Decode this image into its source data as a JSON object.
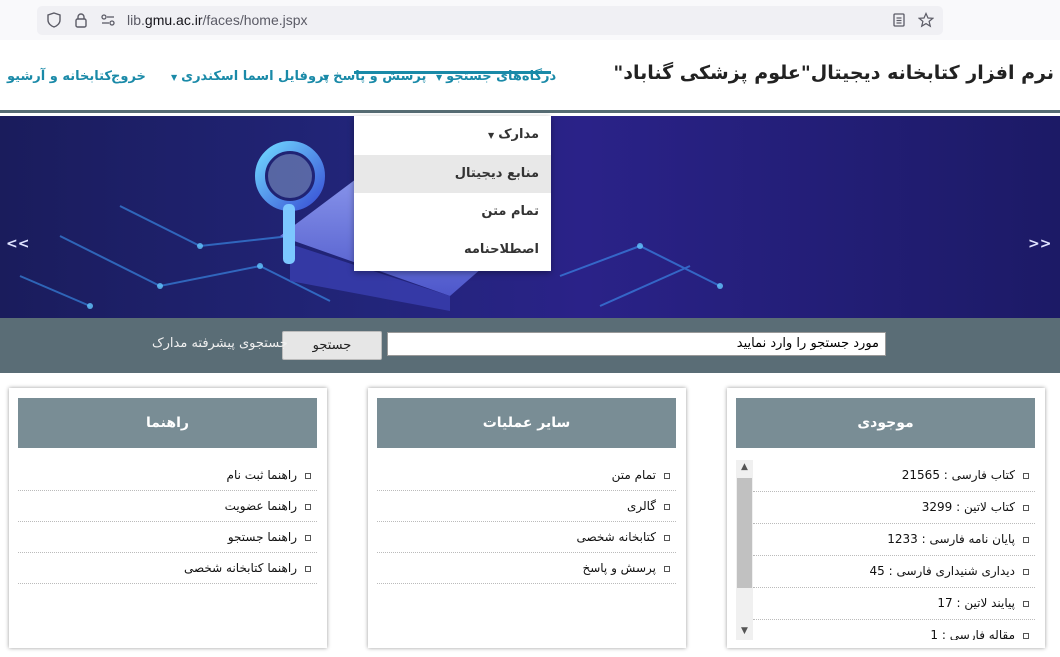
{
  "browser": {
    "url_prefix": "lib.",
    "url_domain": "gmu.ac.ir",
    "url_path": "/faces/home.jspx"
  },
  "header": {
    "site_title": "نرم افزار کتابخانه دیجیتال\"علوم پزشکی گناباد\"",
    "nav": {
      "search_portals": "درگاه‌های جستجو",
      "qa": "پرسش و پاسخ",
      "profile": "پروفایل اسما اسکندری",
      "logout": "خروج",
      "library": "کتابخانه و آرشیو"
    }
  },
  "dropdown": {
    "documents": "مدارک",
    "digital_resources": "منابع دیجیتال",
    "full_text": "تمام متن",
    "thesaurus": "اصطلاحنامه"
  },
  "banner": {
    "prev": "<<",
    "next": ">>"
  },
  "search": {
    "value": "مورد جستجو را وارد نمایید",
    "button": "جستجو",
    "advanced": "جستجوی پیشرفته مدارک"
  },
  "panels": {
    "guide": {
      "title": "راهنما",
      "items": [
        "راهنما ثبت نام",
        "راهنما عضویت",
        "راهنما جستجو",
        "راهنما کتابخانه شخصی"
      ]
    },
    "other_ops": {
      "title": "سایر عملیات",
      "items": [
        "تمام متن",
        "گالری",
        "کتابخانه شخصی",
        "پرسش و پاسخ"
      ]
    },
    "inventory": {
      "title": "موجودی",
      "items": [
        "کتاب فارسی : 21565",
        "کتاب لاتین : 3299",
        "پایان نامه فارسی : 1233",
        "دیداری شنیداری فارسی : 45",
        "پیایند لاتین : 17",
        "مقاله فارسی : 1"
      ]
    }
  },
  "colors": {
    "accent": "#1a8aa8",
    "panel_head": "#798d95",
    "search_strip": "#5a6d76"
  }
}
